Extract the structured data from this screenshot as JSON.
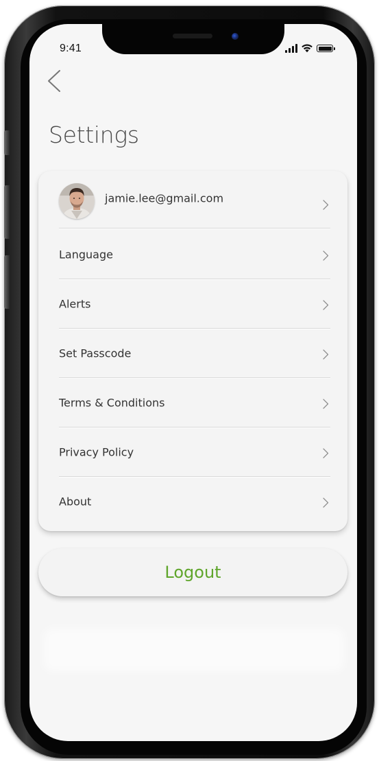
{
  "status_bar": {
    "time": "9:41",
    "signal_icon": "cellular-signal-icon",
    "wifi_icon": "wifi-icon",
    "battery_icon": "battery-icon"
  },
  "header": {
    "back_icon": "chevron-left-icon",
    "title": "Settings"
  },
  "settings": {
    "profile": {
      "email": "jamie.lee@gmail.com",
      "avatar_icon": "user-avatar"
    },
    "items": [
      {
        "label": "Language"
      },
      {
        "label": "Alerts"
      },
      {
        "label": "Set Passcode"
      },
      {
        "label": "Terms & Conditions"
      },
      {
        "label": "Privacy Policy"
      },
      {
        "label": "About"
      }
    ],
    "chevron_icon": "chevron-right-icon"
  },
  "logout": {
    "label": "Logout"
  },
  "colors": {
    "accent": "#5fa52b",
    "background": "#f6f6f6",
    "card": "#f4f4f4",
    "text": "#333333"
  }
}
